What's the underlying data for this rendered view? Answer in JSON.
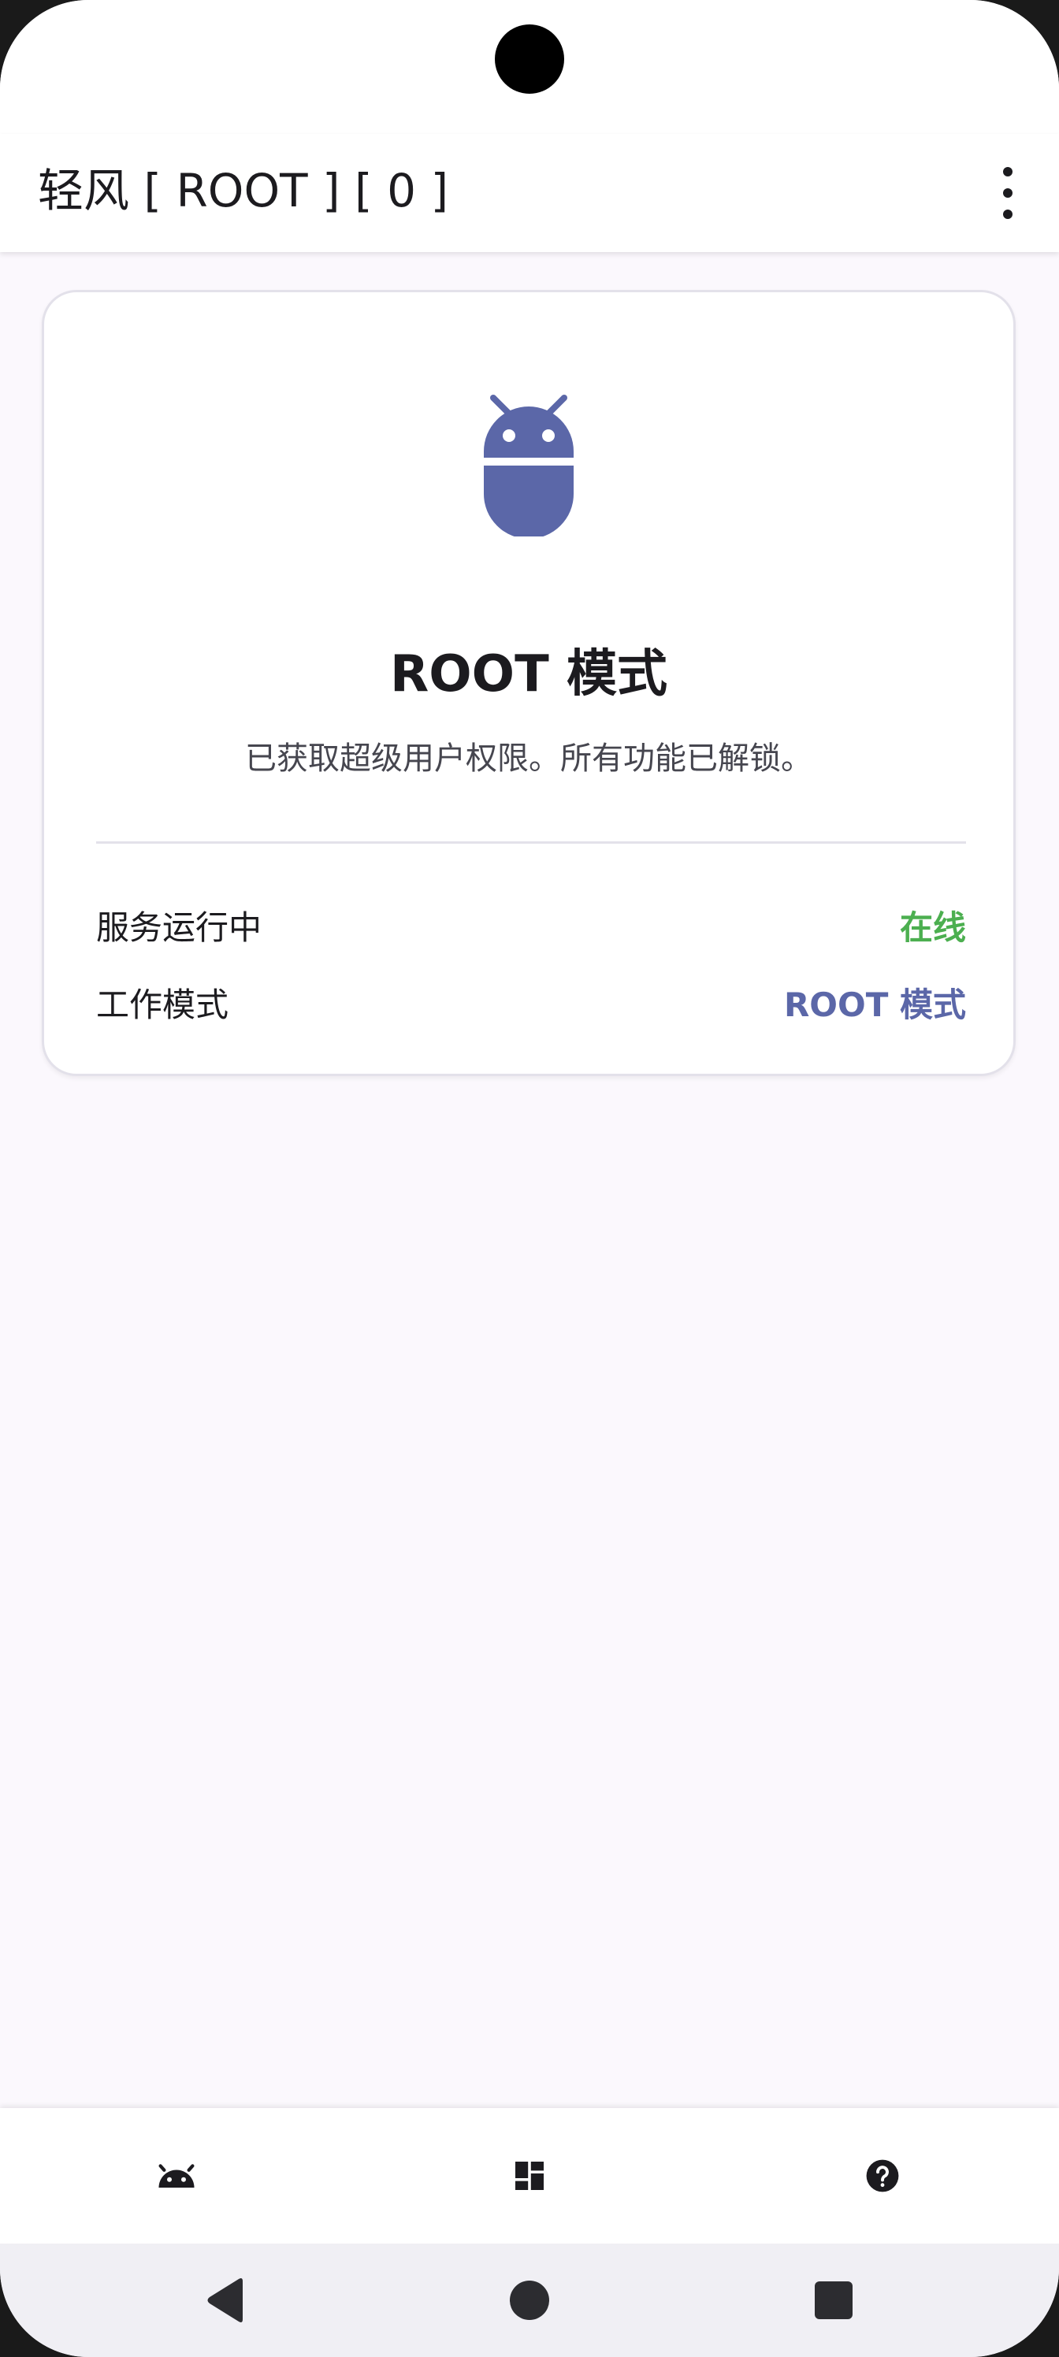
{
  "app_bar": {
    "title": "轻风 [ ROOT ] [ 0 ]",
    "menu_icon": "more-vert-icon"
  },
  "status_card": {
    "icon": "android-robot-icon",
    "title": "ROOT 模式",
    "description": "已获取超级用户权限。所有功能已解锁。",
    "rows": [
      {
        "label": "服务运行中",
        "value": "在线",
        "color": "#4caf50"
      },
      {
        "label": "工作模式",
        "value": "ROOT 模式",
        "color": "#5b67a8"
      }
    ]
  },
  "bottom_nav": {
    "items": [
      {
        "icon": "android-icon"
      },
      {
        "icon": "dashboard-icon"
      },
      {
        "icon": "help-icon"
      }
    ]
  },
  "system_nav": [
    "back-icon",
    "home-icon",
    "recents-icon"
  ],
  "colors": {
    "accent": "#5b67a8",
    "online": "#4caf50",
    "background": "#fbf8fd"
  }
}
